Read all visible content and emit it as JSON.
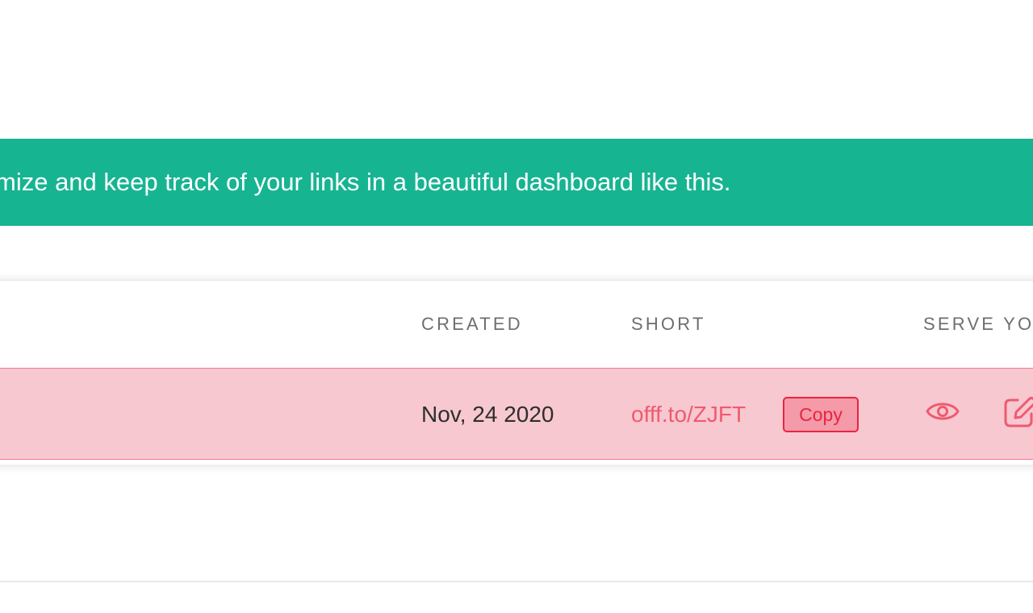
{
  "banner": {
    "text": "mize and keep track of your links in a beautiful dashboard like this.",
    "color": "#17b492"
  },
  "table": {
    "headers": {
      "created": "CREATED",
      "short": "SHORT",
      "serve": "SERVE YOU"
    },
    "rows": [
      {
        "created": "Nov, 24 2020",
        "short": "offf.to/ZJFT",
        "copy_label": "Copy",
        "actions": [
          "eye-icon",
          "edit-icon"
        ]
      }
    ]
  },
  "colors": {
    "row_highlight": "#f7c8cf",
    "accent": "#ef5a70",
    "copy_border": "#e8253f"
  }
}
